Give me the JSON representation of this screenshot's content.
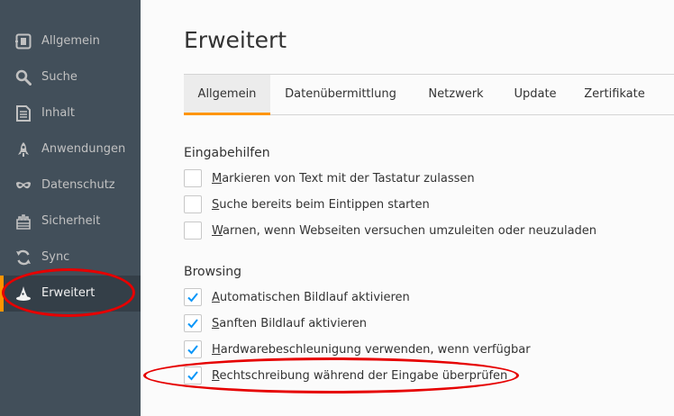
{
  "sidebar": {
    "items": [
      {
        "label": "Allgemein",
        "icon": "general-icon"
      },
      {
        "label": "Suche",
        "icon": "search-icon"
      },
      {
        "label": "Inhalt",
        "icon": "document-icon"
      },
      {
        "label": "Anwendungen",
        "icon": "rocket-icon"
      },
      {
        "label": "Datenschutz",
        "icon": "mask-icon"
      },
      {
        "label": "Sicherheit",
        "icon": "castle-icon"
      },
      {
        "label": "Sync",
        "icon": "sync-icon"
      },
      {
        "label": "Erweitert",
        "icon": "wizard-hat-icon",
        "active": true
      }
    ]
  },
  "main": {
    "title": "Erweitert",
    "tabs": [
      {
        "label": "Allgemein",
        "active": true
      },
      {
        "label": "Datenübermittlung"
      },
      {
        "label": "Netzwerk"
      },
      {
        "label": "Update"
      },
      {
        "label": "Zertifikate"
      }
    ],
    "groups": [
      {
        "title": "Eingabehilfen",
        "options": [
          {
            "mnemonic": "M",
            "rest": "arkieren von Text mit der Tastatur zulassen",
            "checked": false
          },
          {
            "mnemonic": "S",
            "rest": "uche bereits beim Eintippen starten",
            "checked": false
          },
          {
            "mnemonic": "W",
            "rest": "arnen, wenn Webseiten versuchen umzuleiten oder neuzuladen",
            "checked": false
          }
        ]
      },
      {
        "title": "Browsing",
        "options": [
          {
            "mnemonic": "A",
            "rest": "utomatischen Bildlauf aktivieren",
            "checked": true
          },
          {
            "mnemonic": "S",
            "rest": "anften Bildlauf aktivieren",
            "checked": true
          },
          {
            "mnemonic": "H",
            "rest": "ardwarebeschleunigung verwenden, wenn verfügbar",
            "checked": true
          },
          {
            "mnemonic": "R",
            "rest": "echtschreibung während der Eingabe überprüfen",
            "checked": true
          }
        ]
      }
    ]
  },
  "colors": {
    "sidebar_bg": "#424f5a",
    "sidebar_active_bg": "#343f48",
    "accent": "#ff9500",
    "checkmark": "#0996f8",
    "annotation": "#e60000"
  }
}
